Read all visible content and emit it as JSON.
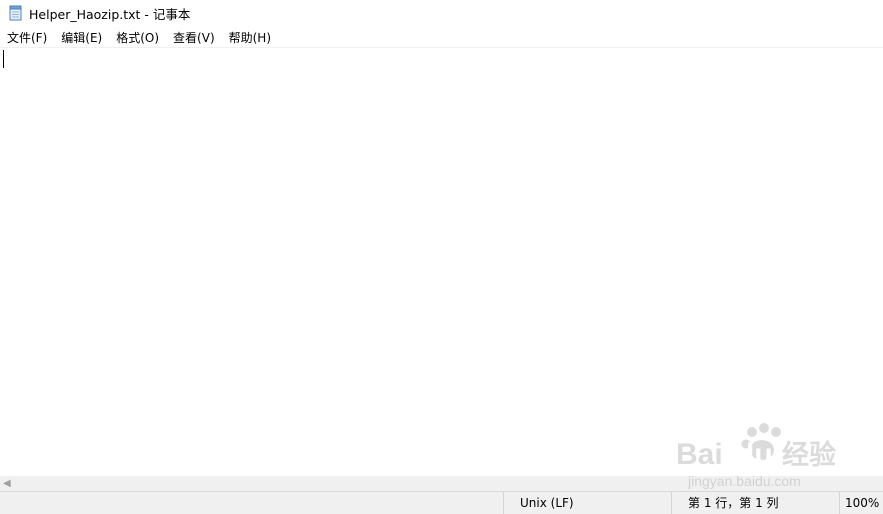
{
  "window": {
    "title": "Helper_Haozip.txt - 记事本",
    "icon": "notepad-icon"
  },
  "menu": {
    "items": [
      {
        "id": "file",
        "label": "文件(F)"
      },
      {
        "id": "edit",
        "label": "编辑(E)"
      },
      {
        "id": "format",
        "label": "格式(O)"
      },
      {
        "id": "view",
        "label": "查看(V)"
      },
      {
        "id": "help",
        "label": "帮助(H)"
      }
    ]
  },
  "editor": {
    "content": ""
  },
  "statusbar": {
    "line_ending": "Unix (LF)",
    "position": "第 1 行，第 1 列",
    "zoom": "100%"
  },
  "watermark": {
    "text": "Bai du 经验",
    "url": "jingyan.baidu.com"
  }
}
